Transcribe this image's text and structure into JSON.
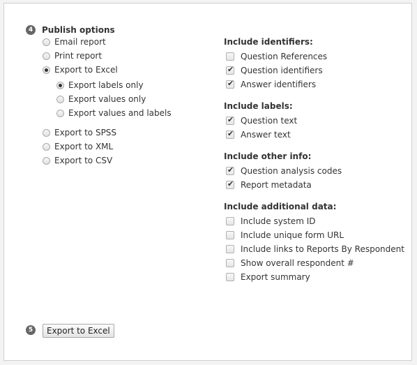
{
  "step4": {
    "number": "4",
    "title": "Publish options",
    "options": [
      {
        "label": "Email report",
        "checked": false
      },
      {
        "label": "Print report",
        "checked": false
      },
      {
        "label": "Export to Excel",
        "checked": true
      },
      {
        "label": "Export to SPSS",
        "checked": false
      },
      {
        "label": "Export to XML",
        "checked": false
      },
      {
        "label": "Export to CSV",
        "checked": false
      }
    ],
    "excel_suboptions": [
      {
        "label": "Export labels only",
        "checked": true
      },
      {
        "label": "Export values only",
        "checked": false
      },
      {
        "label": "Export values and labels",
        "checked": false
      }
    ]
  },
  "identifiers": {
    "title": "Include identifiers:",
    "items": [
      {
        "label": "Question References",
        "checked": false
      },
      {
        "label": "Question identifiers",
        "checked": true
      },
      {
        "label": "Answer identifiers",
        "checked": true
      }
    ]
  },
  "labels": {
    "title": "Include labels:",
    "items": [
      {
        "label": "Question text",
        "checked": true
      },
      {
        "label": "Answer text",
        "checked": true
      }
    ]
  },
  "other_info": {
    "title": "Include other info:",
    "items": [
      {
        "label": "Question analysis codes",
        "checked": true
      },
      {
        "label": "Report metadata",
        "checked": true
      }
    ]
  },
  "additional_data": {
    "title": "Include additional data:",
    "items": [
      {
        "label": "Include system ID",
        "checked": false
      },
      {
        "label": "Include unique form URL",
        "checked": false
      },
      {
        "label": "Include links to Reports By Respondent",
        "checked": false
      },
      {
        "label": "Show overall respondent #",
        "checked": false
      },
      {
        "label": "Export summary",
        "checked": false
      }
    ]
  },
  "step5": {
    "number": "5",
    "button_label": "Export to Excel"
  }
}
